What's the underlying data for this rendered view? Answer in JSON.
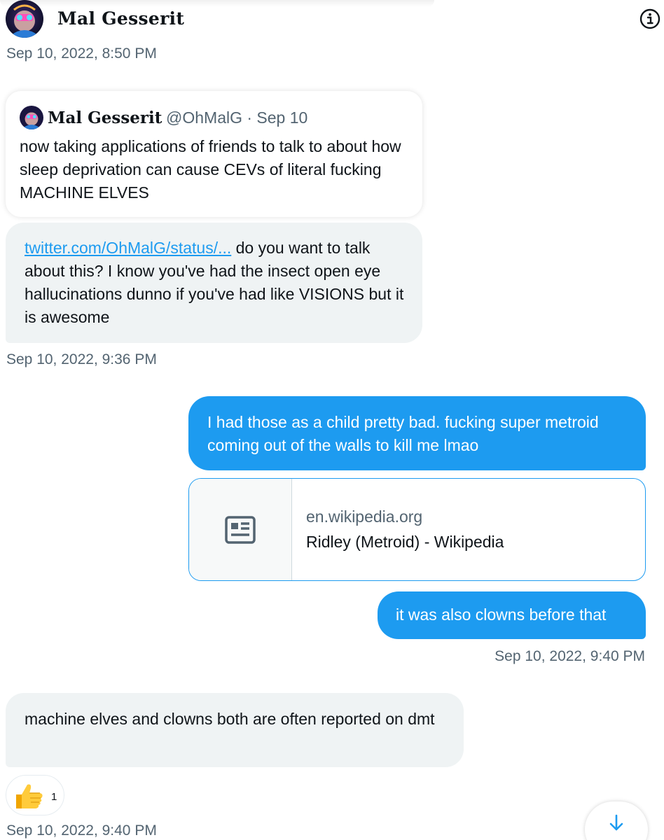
{
  "header": {
    "display_name": "Mal Gesserit",
    "info_icon": "info-circle-icon"
  },
  "messages": {
    "first_timestamp": "Sep 10, 2022, 8:50 PM",
    "quoted_tweet": {
      "name": "Mal Gesserit",
      "handle_date": "@OhMalG · Sep 10",
      "text": "now taking applications of friends to talk to about how sleep deprivation can cause CEVs of literal fucking MACHINE ELVES"
    },
    "received_1": {
      "link": "twitter.com/OhMalG/status/...",
      "text": " do you want to talk about this? I know you've had the insect open eye hallucinations dunno if you've had like VISIONS but it is awesome"
    },
    "timestamp_2": "Sep 10, 2022, 9:36 PM",
    "sent_1": "I had those as a child pretty bad. fucking super metroid coming out of the walls to kill me lmao",
    "link_card": {
      "domain": "en.wikipedia.org",
      "title": "Ridley (Metroid) - Wikipedia",
      "icon": "article-icon"
    },
    "sent_2": "it was also clowns before that",
    "timestamp_3": "Sep 10, 2022, 9:40 PM",
    "received_2": "machine elves and clowns both are often reported on dmt",
    "reaction": {
      "icon": "thumbs-up-icon",
      "count": "1"
    },
    "timestamp_4": "Sep 10, 2022, 9:40 PM"
  },
  "scroll_button_icon": "arrow-down-icon",
  "colors": {
    "accent": "#1d9bf0",
    "received_bubble": "#eff3f4",
    "secondary_text": "#536471",
    "primary_text": "#0f1419"
  }
}
